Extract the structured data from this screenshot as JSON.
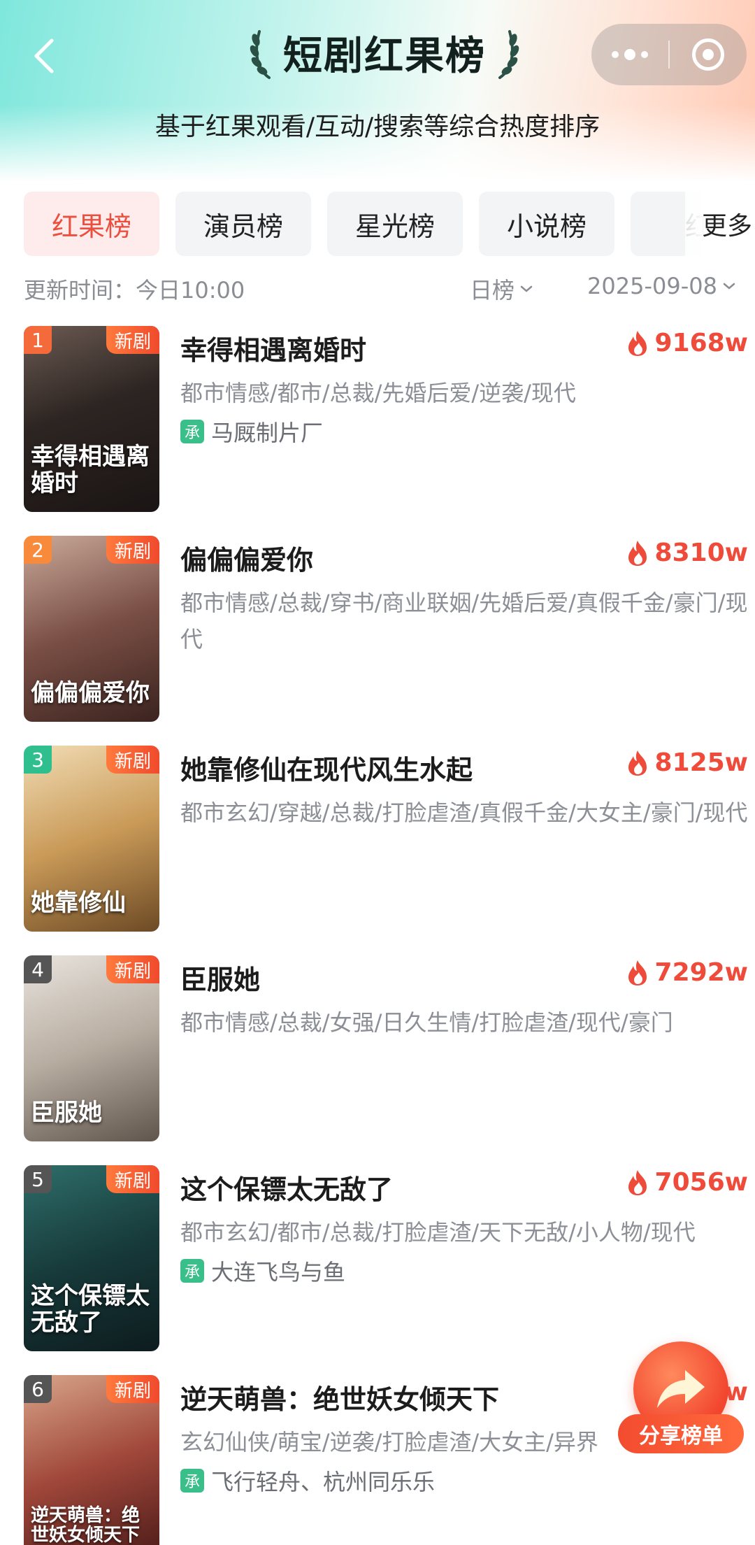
{
  "header": {
    "title": "短剧红果榜",
    "subtitle": "基于红果观看/互动/搜索等综合热度排序",
    "back_icon": "chevron-left-icon",
    "capsule_icons": [
      "more-dots-icon",
      "target-icon"
    ]
  },
  "tabs": [
    {
      "label": "红果榜",
      "active": true
    },
    {
      "label": "演员榜",
      "active": false
    },
    {
      "label": "星光榜",
      "active": false
    },
    {
      "label": "小说榜",
      "active": false
    },
    {
      "label": "红",
      "active": false
    }
  ],
  "tabs_more_label": "更多",
  "meta": {
    "update_time": "更新时间：今日10:00",
    "period": "日榜",
    "date": "2025-09-08"
  },
  "items": [
    {
      "rank": "1",
      "badge": "新剧",
      "title": "幸得相遇离婚时",
      "heat": "9168w",
      "tags": "都市情感/都市/总裁/先婚后爱/逆袭/现代",
      "producer": "马厩制片厂",
      "producer_icon_label": "承",
      "poster_text": "幸得相遇离婚时"
    },
    {
      "rank": "2",
      "badge": "新剧",
      "title": "偏偏偏爱你",
      "heat": "8310w",
      "tags": "都市情感/总裁/穿书/商业联姻/先婚后爱/真假千金/豪门/现代",
      "producer": "",
      "producer_icon_label": "",
      "poster_text": "偏偏偏爱你"
    },
    {
      "rank": "3",
      "badge": "新剧",
      "title": "她靠修仙在现代风生水起",
      "heat": "8125w",
      "tags": "都市玄幻/穿越/总裁/打脸虐渣/真假千金/大女主/豪门/现代",
      "producer": "",
      "producer_icon_label": "",
      "poster_text": "她靠修仙"
    },
    {
      "rank": "4",
      "badge": "新剧",
      "title": "臣服她",
      "heat": "7292w",
      "tags": "都市情感/总裁/女强/日久生情/打脸虐渣/现代/豪门",
      "producer": "",
      "producer_icon_label": "",
      "poster_text": "臣服她"
    },
    {
      "rank": "5",
      "badge": "新剧",
      "title": "这个保镖太无敌了",
      "heat": "7056w",
      "tags": "都市玄幻/都市/总裁/打脸虐渣/天下无敌/小人物/现代",
      "producer": "大连飞鸟与鱼",
      "producer_icon_label": "承",
      "poster_text": "这个保镖太无敌了"
    },
    {
      "rank": "6",
      "badge": "新剧",
      "title": "逆天萌兽：绝世妖女倾天下",
      "heat": "w",
      "tags": "玄幻仙侠/萌宝/逆袭/打脸虐渣/大女主/异界",
      "producer": "飞行轻舟、杭州同乐乐",
      "producer_icon_label": "承",
      "poster_text": "逆天萌兽：绝世妖女倾天下"
    }
  ],
  "share": {
    "label": "分享榜单"
  },
  "colors": {
    "accent": "#ea4f3f",
    "rank_1": "#f46a3a",
    "rank_2": "#f78b3b",
    "rank_3": "#2fbf8f",
    "rank_other": "#555555",
    "producer_icon": "#3bbf8a"
  }
}
